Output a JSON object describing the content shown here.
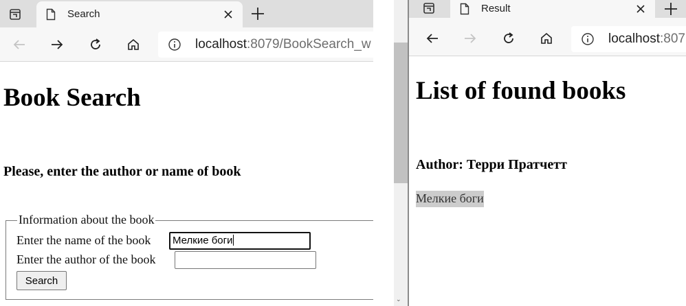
{
  "left_window": {
    "tab": {
      "title": "Search",
      "icon": "page-icon"
    },
    "address": {
      "host": "localhost",
      "rest": ":8079/BookSearch_w"
    },
    "page": {
      "title": "Book Search",
      "prompt": "Please, enter the author or name of book",
      "fieldset_legend": "Information about the book",
      "name_label": "Enter the name of the book",
      "name_value": "Мелкие боги",
      "author_label": "Enter the author of the book",
      "author_value": "",
      "search_button": "Search"
    }
  },
  "right_window": {
    "tab": {
      "title": "Result",
      "icon": "page-icon"
    },
    "address": {
      "host": "localhost",
      "rest": ":807"
    },
    "page": {
      "title": "List of found books",
      "author_heading": "Author: Терри Пратчетт",
      "books": [
        "Мелкие боги"
      ]
    }
  },
  "colors": {
    "tabstrip": "#dedede",
    "toolbar": "#f7f7f7",
    "result_highlight": "#cccccc"
  }
}
